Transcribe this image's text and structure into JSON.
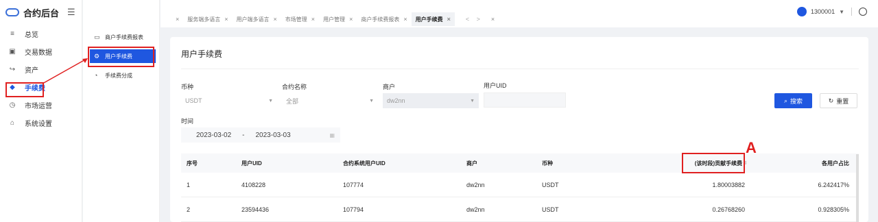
{
  "app": {
    "logo_text": "合约后台",
    "fold_icon": "menu-fold-icon"
  },
  "sidebar": {
    "items": [
      {
        "label": "总览",
        "icon": "menu-icon"
      },
      {
        "label": "交易数据",
        "icon": "chart-icon"
      },
      {
        "label": "资产",
        "icon": "asset-icon"
      },
      {
        "label": "手续费",
        "icon": "shield-icon",
        "active": true
      },
      {
        "label": "市场运营",
        "icon": "clock-icon"
      },
      {
        "label": "系统设置",
        "icon": "settings-icon"
      }
    ]
  },
  "submenu": {
    "items": [
      {
        "label": "商户手续费报表",
        "icon": "report-icon"
      },
      {
        "label": "用户手续费",
        "icon": "gear-icon",
        "active": true
      },
      {
        "label": "手续费分成",
        "icon": "pie-icon"
      }
    ]
  },
  "tabs": [
    {
      "label": "服务端多语言"
    },
    {
      "label": "用户端多语言"
    },
    {
      "label": "市场管理"
    },
    {
      "label": "用户管理"
    },
    {
      "label": "商户手续费报表"
    },
    {
      "label": "用户手续费",
      "active": true
    }
  ],
  "tab_nav": "< >",
  "user": {
    "name": "1300001"
  },
  "page": {
    "title": "用户手续费"
  },
  "filters": {
    "currency_label": "币种",
    "currency_value": "USDT",
    "contract_label": "合约名称",
    "contract_value": "全部",
    "merchant_label": "商户",
    "merchant_value": "dw2nn",
    "uid_label": "用户UID",
    "uid_value": "",
    "time_label": "时间",
    "date_start": "2023-03-02",
    "date_sep": "-",
    "date_end": "2023-03-03",
    "search_label": "搜索",
    "reset_label": "重置"
  },
  "table": {
    "columns": [
      "序号",
      "用户UID",
      "合约系统用户UID",
      "商户",
      "币种",
      "(该时段)贡献手续费",
      "各用户占比"
    ],
    "rows": [
      [
        "1",
        "4108228",
        "107774",
        "dw2nn",
        "USDT",
        "1.80003882",
        "6.242417%"
      ],
      [
        "2",
        "23594436",
        "107794",
        "dw2nn",
        "USDT",
        "0.26768260",
        "0.928305%"
      ]
    ]
  },
  "annotation": {
    "label": "A",
    "color": "#e02020"
  },
  "colors": {
    "primary": "#1f57e0",
    "annotation": "#e02020"
  }
}
